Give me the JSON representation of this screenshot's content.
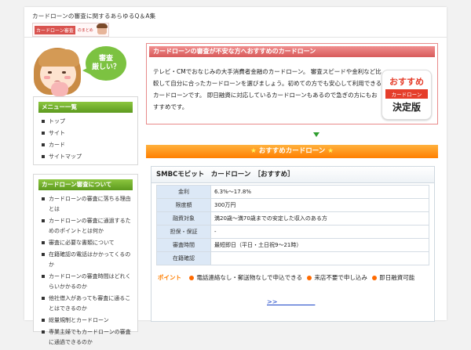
{
  "header": {
    "site_description": "カードローンの審査に関するあらゆるQ＆A集",
    "logo_text": "カードローン審査",
    "logo_sub": "のまとめ"
  },
  "mascot": {
    "bubble_line1": "審査",
    "bubble_line2": "厳しい？"
  },
  "sidebar": {
    "menu_title": "メニュー一覧",
    "menu_items": [
      "トップ",
      "サイト",
      "カード",
      "サイトマップ"
    ],
    "articles_title": "カードローン審査について",
    "article_items": [
      "カードローンの審査に落ちる理由とは",
      "カードローンの審査に通過するためのポイントとは何か",
      "審査に必要な書類について",
      "在籍確認の電話はかかってくるのか",
      "カードローンの審査時間はどれくらいかかるのか",
      "他社借入があっても審査に通ることはできるのか",
      "総量規制とカードローン",
      "専業主婦でもカードローンの審査に通過できるのか"
    ]
  },
  "notice": {
    "title": "カードローンの審査が不安な方へおすすめのカードローン",
    "body": "テレビ・CMでおなじみの大手消費者金融のカードローン。 審査スピードや金利など比較して自分に合ったカードローンを選びましょう。初めての方でも安心して利用できるカードローンです。 即日融資に対応しているカードローンもあるので急ぎの方にもおすすめです。"
  },
  "badge": {
    "line1": "おすすめ",
    "line2": "カードローン",
    "line3": "決定版"
  },
  "ranking": {
    "star": "★",
    "title": "おすすめカードローン"
  },
  "product": {
    "title": "SMBCモビット　カードローン　［おすすめ］",
    "specs": [
      {
        "key": "金利",
        "value": "6.3%〜17.8%"
      },
      {
        "key": "限度額",
        "value": "300万円"
      },
      {
        "key": "融資対象",
        "value": "満20歳〜満70歳までの安定した収入のある方"
      },
      {
        "key": "担保・保証",
        "value": "-"
      },
      {
        "key": "審査時間",
        "value": "最短即日（平日・土日祝9〜21時）"
      },
      {
        "key": "在籍確認",
        "value": ""
      }
    ],
    "features_label": "ポイント",
    "features": [
      "電話連絡なし・郵送物なしで申込できる",
      "来店不要で申し込み",
      "即日融資可能"
    ],
    "link_text": ">>　　　　　　"
  },
  "colors": {
    "accent_green": "#8cc63f",
    "accent_orange": "#ff7f00",
    "notice_red": "#d85a5a",
    "link_blue": "#1a44c8"
  }
}
